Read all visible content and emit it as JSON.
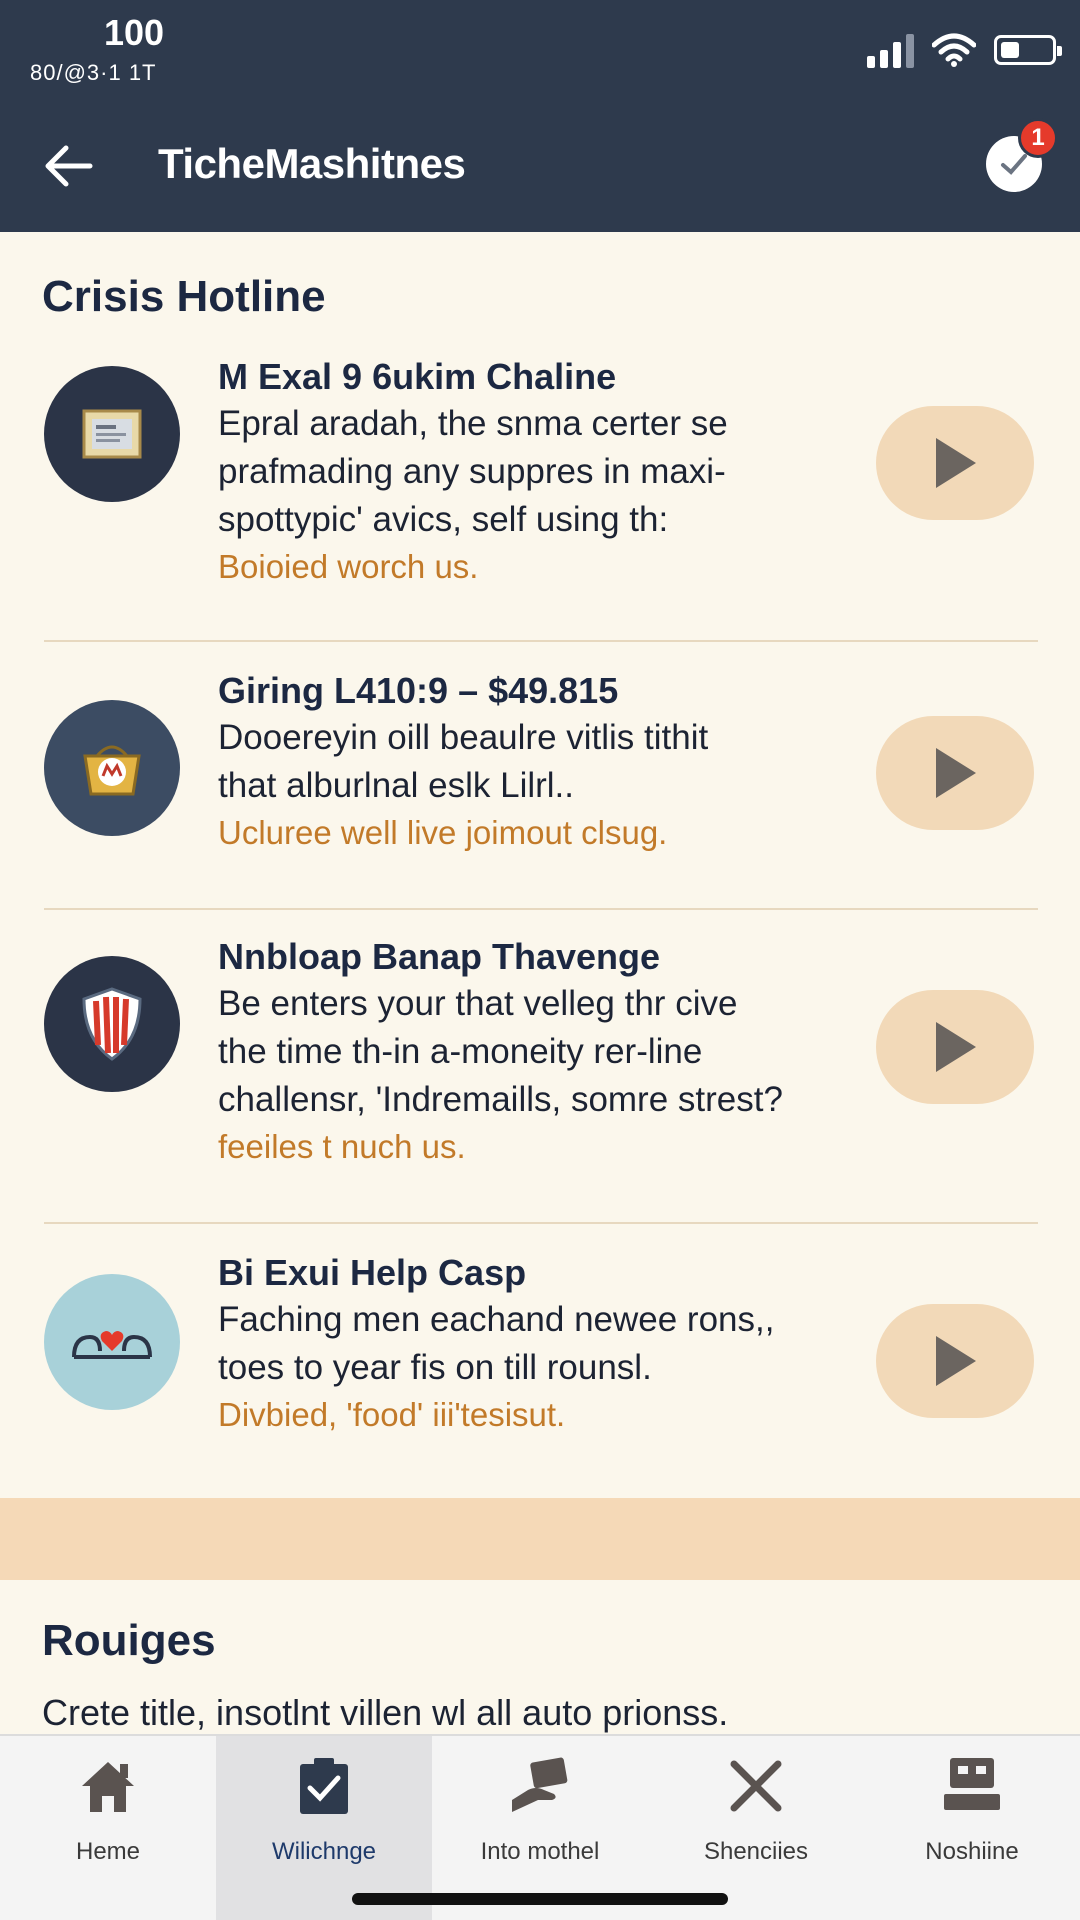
{
  "status_bar": {
    "time": "100",
    "date": "80/@3·1 1T",
    "battery_level": 0.35
  },
  "header": {
    "title": "TicheMashitnes",
    "notification_count": "1"
  },
  "crisis": {
    "title": "Crisis Hotline",
    "items": [
      {
        "title": "M Exal 9 6ukim Chaline",
        "desc_lines": [
          "Epral aradah, the snma certer se",
          "prafmading any suppres in maxi-",
          "spottypic' avics, self using th:"
        ],
        "note": "Boioied worch us.",
        "icon": "certificate-icon",
        "icon_bg": "#2b3447"
      },
      {
        "title": "Giring L410:9 – $49.815",
        "desc_lines": [
          "Dooereyin oill beaulre vitlis tithit",
          "that alburlnal eslk Lilrl.."
        ],
        "note": "Ucluree well live joimout clsug.",
        "icon": "basket-icon",
        "icon_bg": "#3c4c63"
      },
      {
        "title": "Nnbloap Banap Thavenge",
        "desc_lines": [
          "Be enters your that velleg thr cive",
          "the time th-in a-moneity rer-line",
          "challensr, 'Indremaills, somre strest?"
        ],
        "note": "feeiles t nuch us.",
        "icon": "shield-icon",
        "icon_bg": "#2b3447"
      },
      {
        "title": "Bi Exui Help Casp",
        "desc_lines": [
          "Faching men eachand newee rons,,",
          "toes to year fis on till rounsl."
        ],
        "note": "Divbied, 'food' iii'tesisut.",
        "icon": "heart-hands-icon",
        "icon_bg": "#a8d1d9"
      }
    ]
  },
  "resources": {
    "title": "Rouiges",
    "text": "Crete title, insotlnt villen wl all auto prionss."
  },
  "bottom_nav": {
    "items": [
      {
        "label": "Heme",
        "icon": "home-icon"
      },
      {
        "label": "Wilichnge",
        "icon": "clipboard-check-icon"
      },
      {
        "label": "Into mothel",
        "icon": "hand-card-icon"
      },
      {
        "label": "Shenciies",
        "icon": "close-x-icon"
      },
      {
        "label": "Noshiine",
        "icon": "device-icon"
      }
    ],
    "active_index": 1
  },
  "colors": {
    "header_bg": "#2e3a4d",
    "page_bg": "#fbf7ec",
    "accent_orange": "#c27a29",
    "play_button_bg": "#f2d9b8",
    "band_bg": "#f5d9b7",
    "badge_red": "#e53a2b",
    "active_nav_text": "#1e3a6b"
  }
}
